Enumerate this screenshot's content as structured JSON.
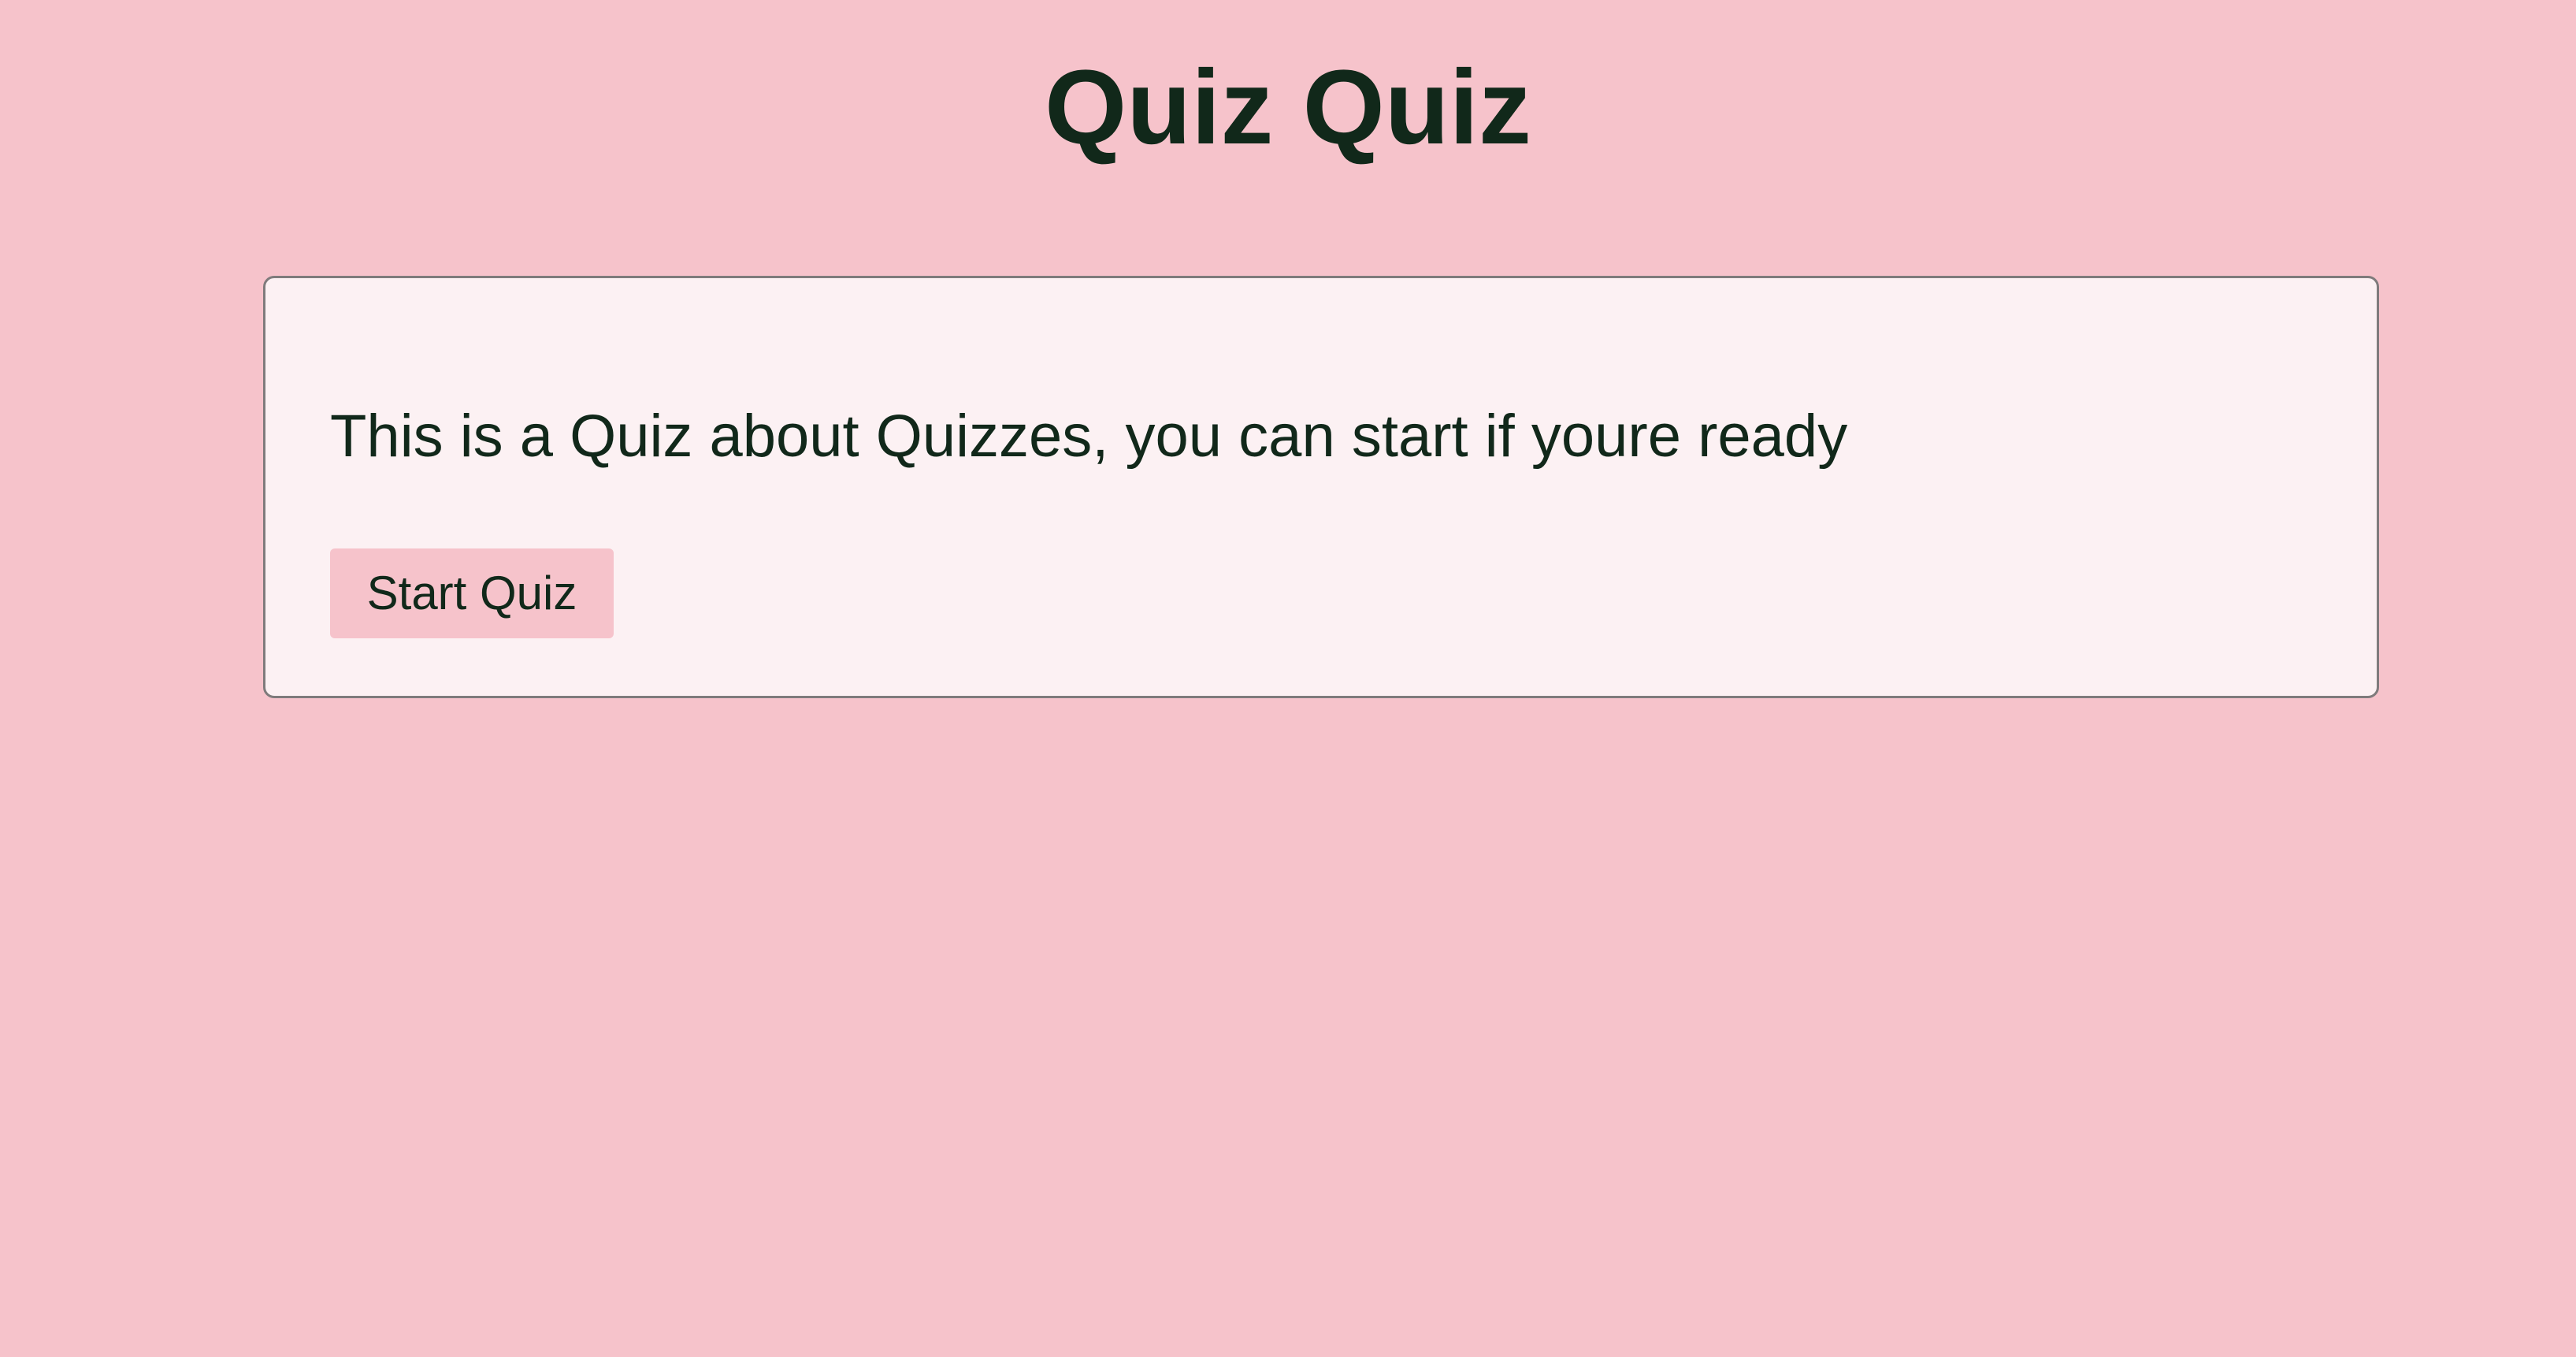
{
  "page": {
    "title": "Quiz Quiz"
  },
  "card": {
    "intro_text": "This is a Quiz about Quizzes, you can start if youre ready",
    "start_button_label": "Start Quiz"
  },
  "colors": {
    "background": "#f6c3cb",
    "card_background": "#fcf1f3",
    "text": "#11281a",
    "button_background": "#f6c3cb"
  }
}
